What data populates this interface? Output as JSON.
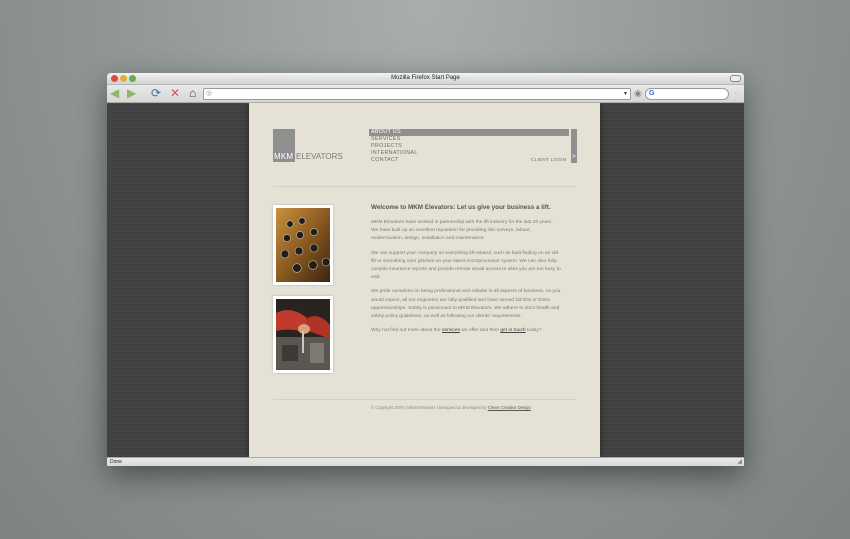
{
  "browser": {
    "title": "Mozilla Firefox Start Page",
    "status": "Done",
    "icons": {
      "back": "◀",
      "forward": "▶",
      "reload": "⟳",
      "stop": "✕",
      "home": "⌂",
      "url_favicon": "◎",
      "url_dropdown": "▼",
      "go": "◉",
      "search_engine": "G",
      "throbber": "◌",
      "resize_grip": "◢"
    }
  },
  "site": {
    "logo": {
      "mkm": "MKM",
      "elevators": "ELEVATORS"
    },
    "nav": [
      "ABOUT US",
      "SERVICES",
      "PROJECTS",
      "INTERNATIONAL",
      "CONTACT"
    ],
    "nav_arrow": ">",
    "client_login": "CLIENT LOGIN",
    "heading": "Welcome to MKM Elevators: Let us give your business a lift.",
    "paragraphs": [
      "MKM Elevators have worked in partnership with the lift industry for the last 20 years. We have built up an excellent reputation for providing site surveys, labour, modernisation, design, installation and maintenance.",
      "We can support your company on everything lift-related, such as fault finding on an old lift or smoothing over glitches on your latest microprocessor system. We can also help compile insurance reports and provide remote visual access to sites you are too busy to visit.",
      "We pride ourselves on being professional and reliable in all aspects of business. As you would expect, all our engineers are fully qualified and have served full Eits or Entra apprenticeships. Safety is paramount to MKM Elevators. We adhere to strict health and safety policy guidelines, as well as following our clients' requirements."
    ],
    "cta": {
      "before": "Why not find out more about the ",
      "services_link": "services",
      "middle": " we offer and then ",
      "touch_link": "get in touch",
      "after": " today?"
    },
    "footer": {
      "text": "© Copyright 2009 | MKM Elevators | Designed & developed by ",
      "link": "Clever Creative Design"
    }
  }
}
